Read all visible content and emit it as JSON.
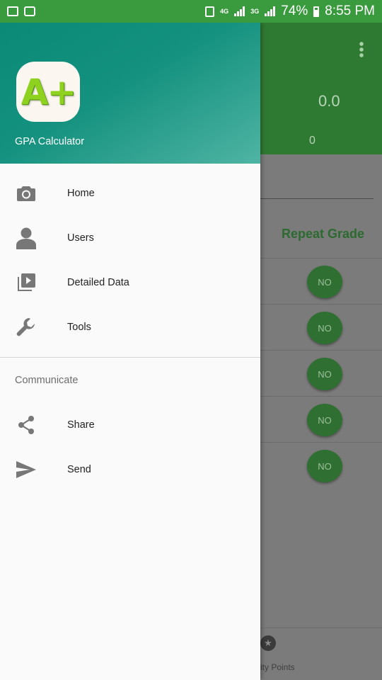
{
  "status_bar": {
    "left_icons": [
      "gallery-icon",
      "wifi-icon"
    ],
    "network_1": "4G",
    "network_2": "3G",
    "battery": "74%",
    "time": "8:55 PM"
  },
  "drawer": {
    "header": {
      "app_icon_text": "A+",
      "app_name": "GPA Calculator"
    },
    "items": [
      {
        "label": "Home",
        "icon": "camera-icon"
      },
      {
        "label": "Users",
        "icon": "user-icon"
      },
      {
        "label": "Detailed Data",
        "icon": "video-library-icon"
      },
      {
        "label": "Tools",
        "icon": "wrench-icon"
      }
    ],
    "section_title": "Communicate",
    "communicate_items": [
      {
        "label": "Share",
        "icon": "share-icon"
      },
      {
        "label": "Send",
        "icon": "send-icon"
      }
    ]
  },
  "background_screen": {
    "score": "0.0",
    "count": "0",
    "column_header": "Repeat Grade",
    "rows": [
      "NO",
      "NO",
      "NO",
      "NO",
      "NO"
    ],
    "bottom_nav_label": "ity Points",
    "colors": {
      "primary": "#3a9a3e",
      "accent": "#2f7a33"
    }
  }
}
